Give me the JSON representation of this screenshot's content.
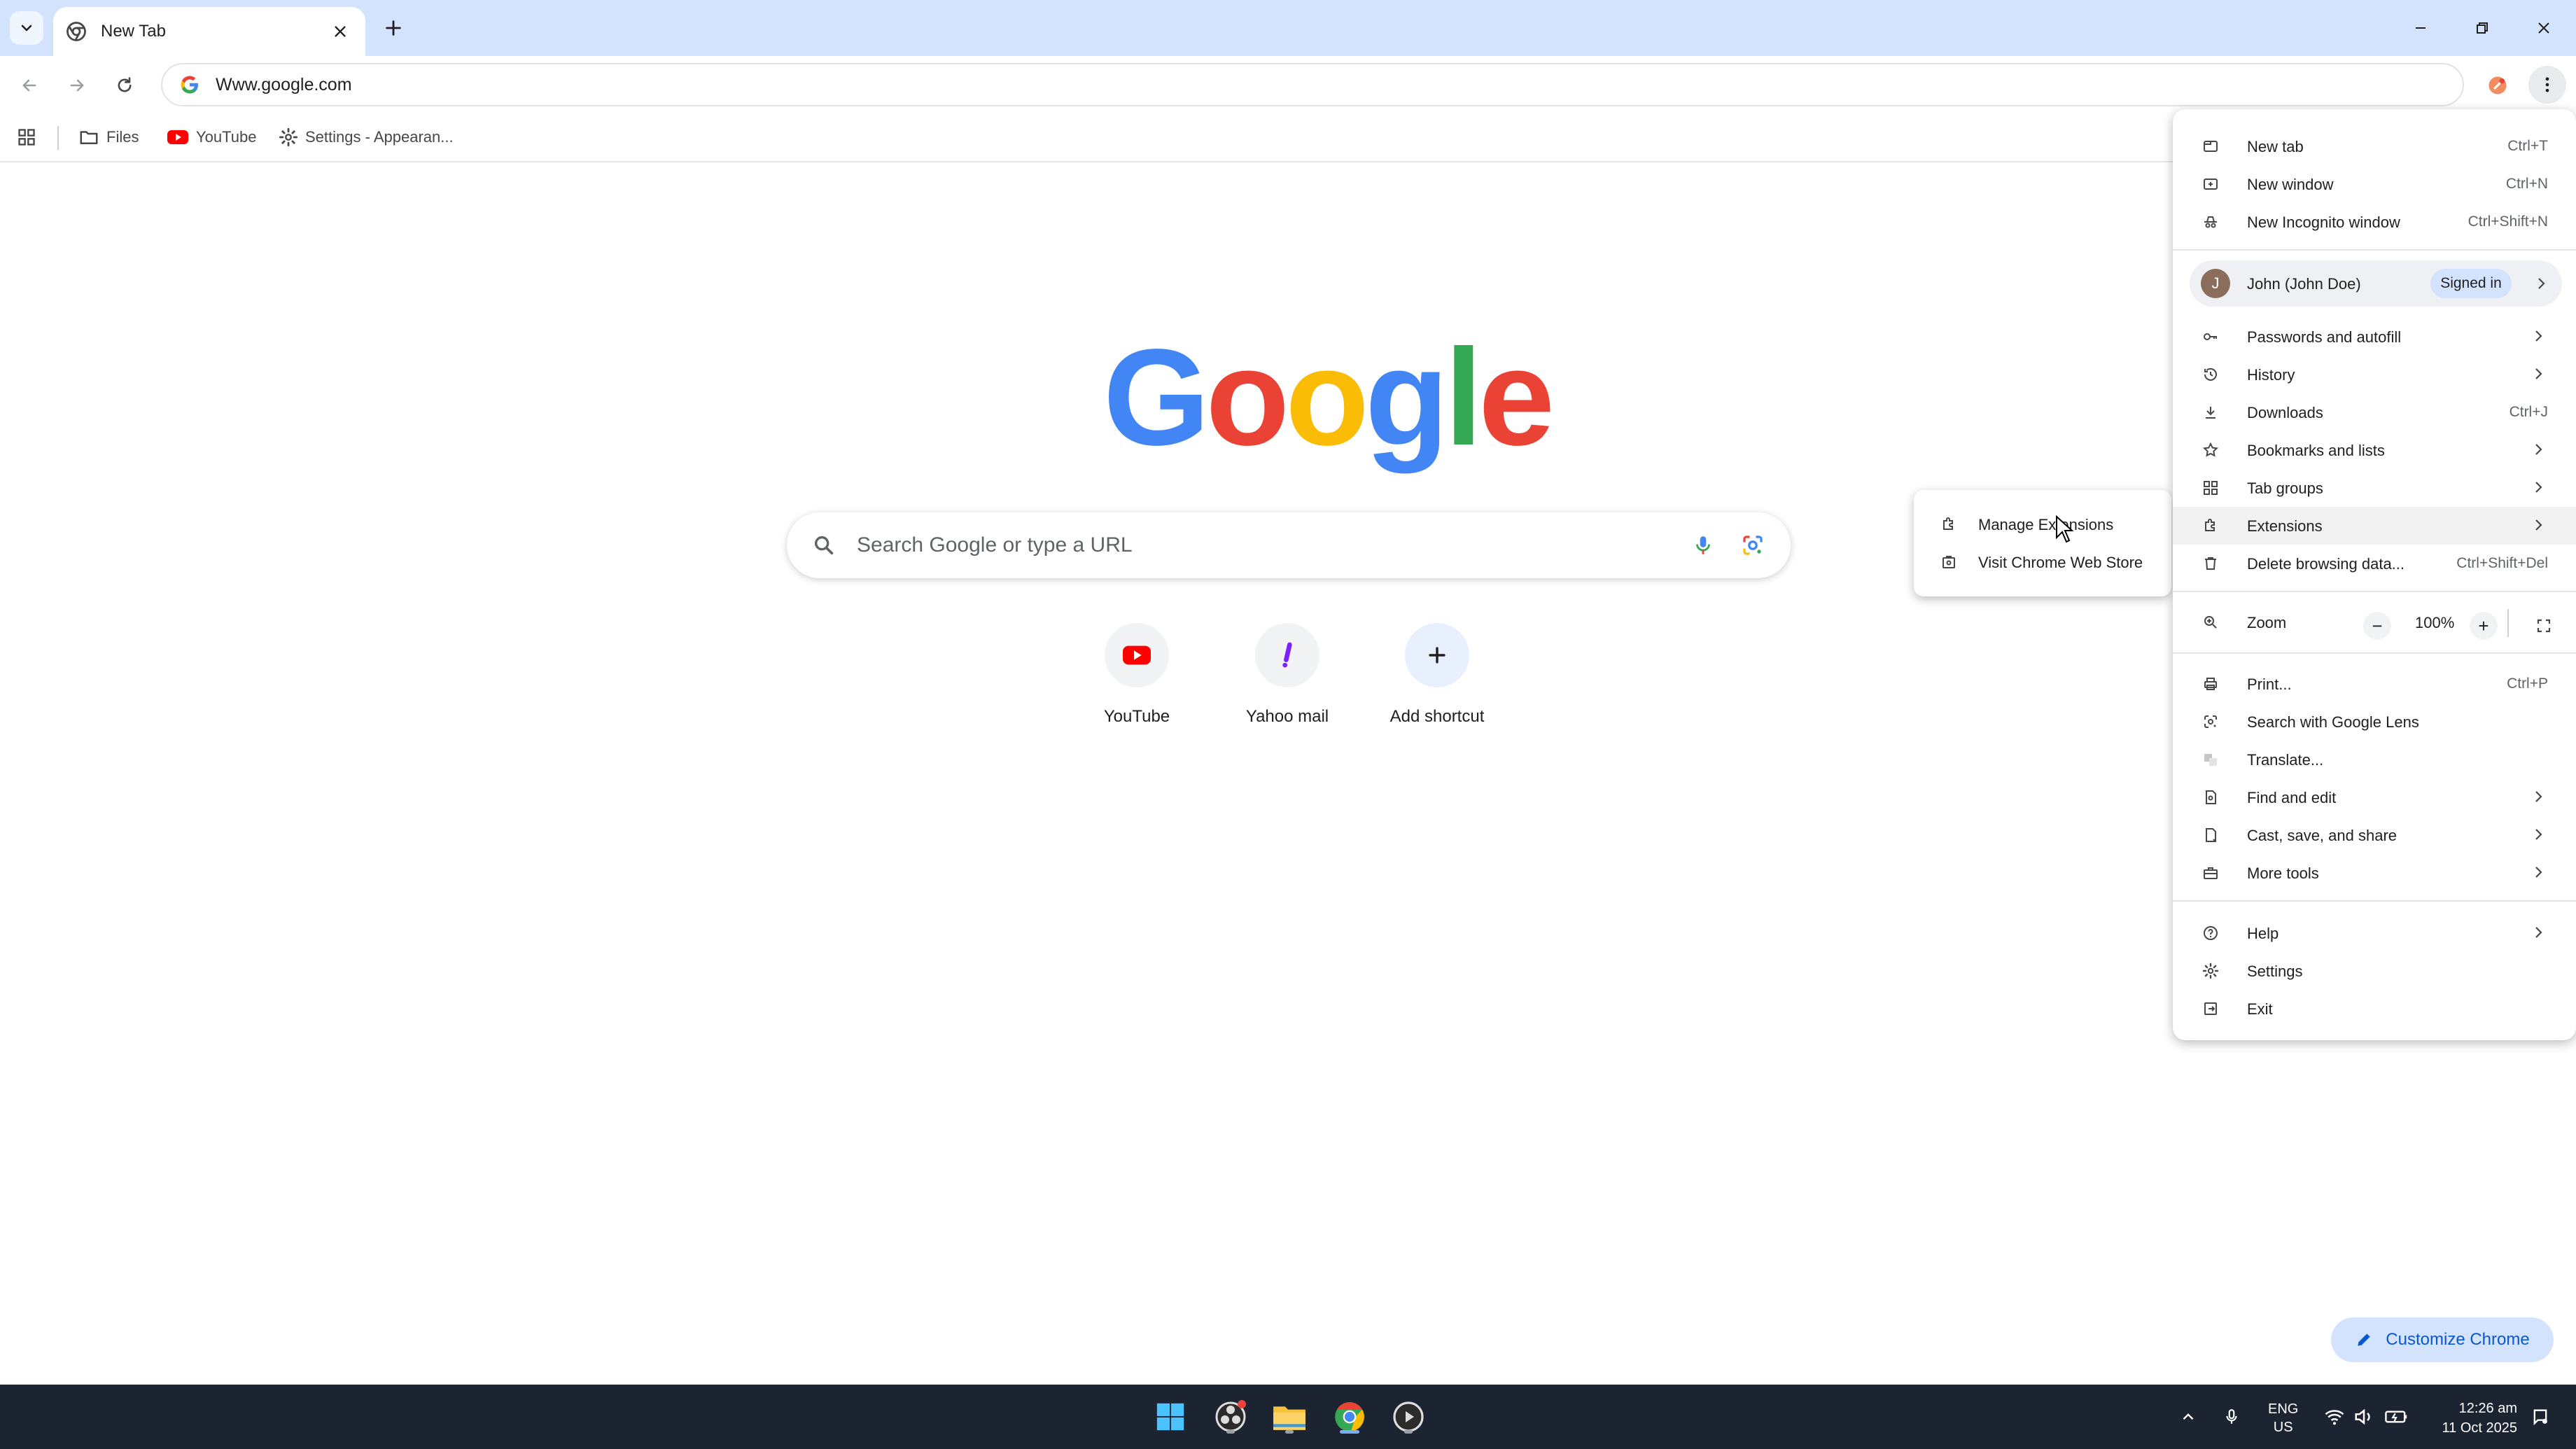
{
  "tab": {
    "title": "New Tab"
  },
  "omnibox": {
    "url": "Www.google.com"
  },
  "bookmarks": [
    {
      "label": "Files"
    },
    {
      "label": "YouTube"
    },
    {
      "label": "Settings - Appearan..."
    }
  ],
  "ntp": {
    "logo": [
      "G",
      "o",
      "o",
      "g",
      "l",
      "e"
    ],
    "search_placeholder": "Search Google or type a URL",
    "shortcuts": [
      {
        "label": "YouTube"
      },
      {
        "label": "Yahoo mail"
      },
      {
        "label": "Add shortcut"
      }
    ],
    "customize_label": "Customize Chrome"
  },
  "menu": {
    "new_tab": {
      "label": "New tab",
      "shortcut": "Ctrl+T"
    },
    "new_window": {
      "label": "New window",
      "shortcut": "Ctrl+N"
    },
    "new_incognito": {
      "label": "New Incognito window",
      "shortcut": "Ctrl+Shift+N"
    },
    "profile": {
      "initial": "J",
      "name": "John (John Doe)",
      "status": "Signed in"
    },
    "passwords": {
      "label": "Passwords and autofill"
    },
    "history": {
      "label": "History"
    },
    "downloads": {
      "label": "Downloads",
      "shortcut": "Ctrl+J"
    },
    "bookmarks": {
      "label": "Bookmarks and lists"
    },
    "tab_groups": {
      "label": "Tab groups"
    },
    "extensions": {
      "label": "Extensions"
    },
    "delete_data": {
      "label": "Delete browsing data...",
      "shortcut": "Ctrl+Shift+Del"
    },
    "zoom": {
      "label": "Zoom",
      "value": "100%",
      "minus": "−",
      "plus": "+"
    },
    "print": {
      "label": "Print...",
      "shortcut": "Ctrl+P"
    },
    "lens": {
      "label": "Search with Google Lens"
    },
    "translate": {
      "label": "Translate..."
    },
    "find_edit": {
      "label": "Find and edit"
    },
    "cast": {
      "label": "Cast, save, and share"
    },
    "more_tools": {
      "label": "More tools"
    },
    "help": {
      "label": "Help"
    },
    "settings": {
      "label": "Settings"
    },
    "exit": {
      "label": "Exit"
    }
  },
  "submenu": {
    "manage": {
      "label": "Manage Extensions"
    },
    "store": {
      "label": "Visit Chrome Web Store"
    }
  },
  "taskbar": {
    "lang_top": "ENG",
    "lang_bottom": "US",
    "time": "12:26 am",
    "date": "11 Oct 2025"
  },
  "colors": {
    "titlebar": "#d3e3fd",
    "accent": "#0b57d0",
    "google_blue": "#4285F4",
    "google_red": "#EA4335",
    "google_yellow": "#FBBC05",
    "google_green": "#34A853",
    "taskbar": "#1c2331"
  }
}
